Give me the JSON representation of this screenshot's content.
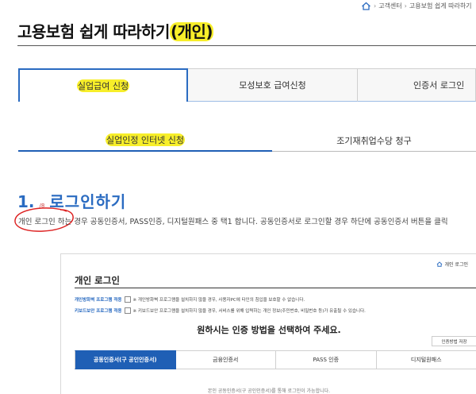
{
  "breadcrumb": {
    "home_icon": "home-icon",
    "items": [
      "고객센터",
      "고용보험 쉽게 따라하기"
    ]
  },
  "page": {
    "title_main": "고용보험 쉽게 따라하기",
    "title_hl": "(개인)"
  },
  "tabs1": [
    {
      "label": "실업급여 신청",
      "active": true
    },
    {
      "label": "모성보호 급여신청",
      "active": false
    },
    {
      "label": "인증서 로그인",
      "active": false
    }
  ],
  "tabs2": [
    {
      "label": "실업인정 인터넷 신청",
      "active": true
    },
    {
      "label": "조기재취업수당 청구",
      "active": false
    }
  ],
  "section": {
    "number": "1.",
    "scribble": "/8",
    "heading": "로그인하기"
  },
  "description": "개인 로그인 하는 경우 공동인증서, PASS인증, 디지털원패스 중 택1 합니다. 공동인증서로 로그인할 경우 하단에 공동인증서 버튼을 클릭",
  "shot": {
    "home_label": "개인 로그인",
    "title": "개인 로그인",
    "prog1_label": "개인방화벽 프로그램 적용",
    "prog1_text": "※ 개인방화벽 프로그램을 설치하지 않을 경우, 사용자PC에 타인의 침입을 보호할 수 없습니다.",
    "prog2_label": "키보드보안 프로그램 적용",
    "prog2_text": "※ 키보드보안 프로그램을 설치하지 않을 경우, 서비스를 위해 입력하는 개인 정보(주민번호, 비밀번호 등)가 유출될 수 있습니다.",
    "choose": "원하시는 인증 방법을 선택하여 주세요.",
    "save_button": "인증방법 저장",
    "method_tabs": [
      {
        "label": "공동인증서(구 공인인증서)",
        "active": true
      },
      {
        "label": "금융인증서",
        "active": false
      },
      {
        "label": "PASS 인증",
        "active": false
      },
      {
        "label": "디지털원패스",
        "active": false
      }
    ],
    "note": "본인 공동인증서(구 공인인증서)를 통해 로그인이 가능합니다."
  },
  "colors": {
    "accent": "#2a6bc1",
    "highlight": "#f7ee2a",
    "annotation": "#d22"
  }
}
